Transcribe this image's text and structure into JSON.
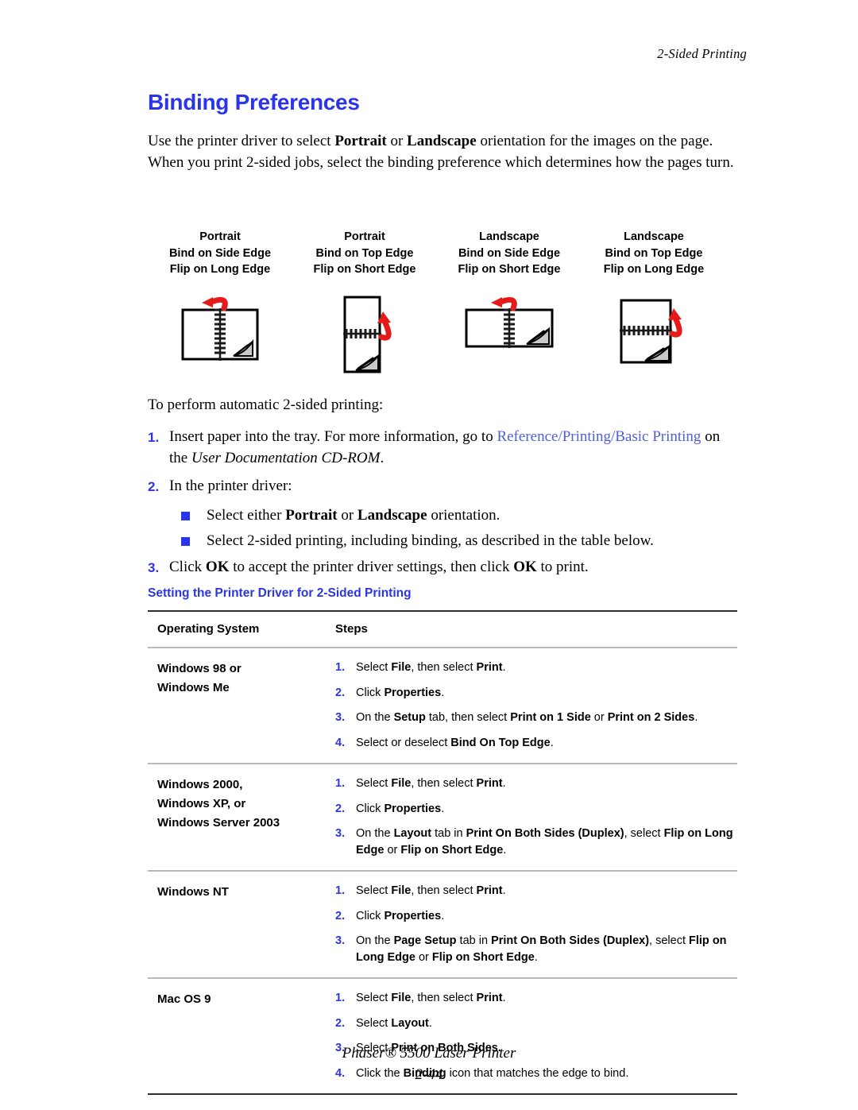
{
  "running_header": "2-Sided Printing",
  "title": "Binding Preferences",
  "intro": {
    "part1": "Use the printer driver to select ",
    "bold1": "Portrait",
    "part2": " or ",
    "bold2": "Landscape",
    "part3": " orientation for the images on the page. When you print 2-sided jobs, select the binding preference which determines how the pages turn."
  },
  "diagrams": [
    {
      "orientation": "Portrait",
      "bind": "Bind on Side Edge",
      "flip": "Flip on Long Edge",
      "icon": "binding-portrait-side-edge-icon"
    },
    {
      "orientation": "Portrait",
      "bind": "Bind on Top Edge",
      "flip": "Flip on Short Edge",
      "icon": "binding-portrait-top-edge-icon"
    },
    {
      "orientation": "Landscape",
      "bind": "Bind on Side Edge",
      "flip": "Flip on Short Edge",
      "icon": "binding-landscape-side-edge-icon"
    },
    {
      "orientation": "Landscape",
      "bind": "Bind on Top Edge",
      "flip": "Flip on Long Edge",
      "icon": "binding-landscape-top-edge-icon"
    }
  ],
  "procedure": {
    "lead": "To perform automatic 2-sided printing:",
    "steps": [
      {
        "num": "1.",
        "pre": "Insert paper into the tray. For more information, go to ",
        "link": "Reference/Printing/Basic Printing",
        "mid": " on the ",
        "italic": "User Documentation CD-ROM",
        "post": "."
      },
      {
        "num": "2.",
        "pre": "In the printer driver:",
        "bullets": [
          {
            "pre": "Select either ",
            "bold1": "Portrait",
            "mid": " or ",
            "bold2": "Landscape",
            "post": " orientation."
          },
          {
            "pre": "Select 2-sided printing, including binding, as described in the table below.",
            "bold1": "",
            "mid": "",
            "bold2": "",
            "post": ""
          }
        ]
      },
      {
        "num": "3.",
        "pre": "Click ",
        "bold1": "OK",
        "mid": " to accept the printer driver settings, then click ",
        "bold2": "OK",
        "post": " to print."
      }
    ]
  },
  "table": {
    "caption": "Setting the Printer Driver for 2-Sided Printing",
    "headers": [
      "Operating System",
      "Steps"
    ],
    "rows": [
      {
        "os": [
          "Windows 98 or",
          "Windows Me"
        ],
        "steps": [
          {
            "num": "1.",
            "segments": [
              {
                "t": "Select ",
                "b": false
              },
              {
                "t": "File",
                "b": true
              },
              {
                "t": ", then select ",
                "b": false
              },
              {
                "t": "Print",
                "b": true
              },
              {
                "t": ".",
                "b": false
              }
            ]
          },
          {
            "num": "2.",
            "segments": [
              {
                "t": "Click ",
                "b": false
              },
              {
                "t": "Properties",
                "b": true
              },
              {
                "t": ".",
                "b": false
              }
            ]
          },
          {
            "num": "3.",
            "segments": [
              {
                "t": "On the ",
                "b": false
              },
              {
                "t": "Setup",
                "b": true
              },
              {
                "t": " tab, then select ",
                "b": false
              },
              {
                "t": "Print on 1 Side",
                "b": true
              },
              {
                "t": " or ",
                "b": false
              },
              {
                "t": "Print on 2 Sides",
                "b": true
              },
              {
                "t": ".",
                "b": false
              }
            ]
          },
          {
            "num": "4.",
            "segments": [
              {
                "t": "Select or deselect ",
                "b": false
              },
              {
                "t": "Bind On Top Edge",
                "b": true
              },
              {
                "t": ".",
                "b": false
              }
            ]
          }
        ]
      },
      {
        "os": [
          "Windows 2000,",
          "Windows XP, or",
          "Windows Server 2003"
        ],
        "steps": [
          {
            "num": "1.",
            "segments": [
              {
                "t": "Select ",
                "b": false
              },
              {
                "t": "File",
                "b": true
              },
              {
                "t": ", then select ",
                "b": false
              },
              {
                "t": "Print",
                "b": true
              },
              {
                "t": ".",
                "b": false
              }
            ]
          },
          {
            "num": "2.",
            "segments": [
              {
                "t": "Click ",
                "b": false
              },
              {
                "t": "Properties",
                "b": true
              },
              {
                "t": ".",
                "b": false
              }
            ]
          },
          {
            "num": "3.",
            "segments": [
              {
                "t": "On the ",
                "b": false
              },
              {
                "t": "Layout",
                "b": true
              },
              {
                "t": " tab in ",
                "b": false
              },
              {
                "t": "Print On Both Sides (Duplex)",
                "b": true
              },
              {
                "t": ", select ",
                "b": false
              },
              {
                "t": "Flip on Long Edge",
                "b": true
              },
              {
                "t": " or ",
                "b": false
              },
              {
                "t": "Flip on Short Edge",
                "b": true
              },
              {
                "t": ".",
                "b": false
              }
            ]
          }
        ]
      },
      {
        "os": [
          "Windows NT"
        ],
        "steps": [
          {
            "num": "1.",
            "segments": [
              {
                "t": "Select ",
                "b": false
              },
              {
                "t": "File",
                "b": true
              },
              {
                "t": ", then select ",
                "b": false
              },
              {
                "t": "Print",
                "b": true
              },
              {
                "t": ".",
                "b": false
              }
            ]
          },
          {
            "num": "2.",
            "segments": [
              {
                "t": "Click ",
                "b": false
              },
              {
                "t": "Properties",
                "b": true
              },
              {
                "t": ".",
                "b": false
              }
            ]
          },
          {
            "num": "3.",
            "segments": [
              {
                "t": "On the ",
                "b": false
              },
              {
                "t": "Page Setup",
                "b": true
              },
              {
                "t": " tab in ",
                "b": false
              },
              {
                "t": "Print On Both Sides (Duplex)",
                "b": true
              },
              {
                "t": ", select ",
                "b": false
              },
              {
                "t": "Flip on Long Edge",
                "b": true
              },
              {
                "t": " or ",
                "b": false
              },
              {
                "t": "Flip on Short Edge",
                "b": true
              },
              {
                "t": ".",
                "b": false
              }
            ]
          }
        ]
      },
      {
        "os": [
          "Mac OS 9"
        ],
        "steps": [
          {
            "num": "1.",
            "segments": [
              {
                "t": "Select ",
                "b": false
              },
              {
                "t": "File",
                "b": true
              },
              {
                "t": ", then select ",
                "b": false
              },
              {
                "t": "Print",
                "b": true
              },
              {
                "t": ".",
                "b": false
              }
            ]
          },
          {
            "num": "2.",
            "segments": [
              {
                "t": "Select ",
                "b": false
              },
              {
                "t": "Layout",
                "b": true
              },
              {
                "t": ".",
                "b": false
              }
            ]
          },
          {
            "num": "3.",
            "segments": [
              {
                "t": "Select ",
                "b": false
              },
              {
                "t": "Print on Both Sides.",
                "b": true
              }
            ]
          },
          {
            "num": "4.",
            "segments": [
              {
                "t": "Click the ",
                "b": false
              },
              {
                "t": "Binding",
                "b": true
              },
              {
                "t": " icon that matches the edge to bind.",
                "b": false
              }
            ]
          }
        ]
      }
    ]
  },
  "footer": {
    "product": "Phaser® 5500 Laser Printer",
    "page_number": "2-44"
  },
  "colors": {
    "heading_blue": "#2b35e8",
    "link_blue": "#5160d8",
    "arrow_red": "#e51b1b",
    "rule_dark": "#2e2e2e",
    "rule_light": "#b9b9b9"
  }
}
